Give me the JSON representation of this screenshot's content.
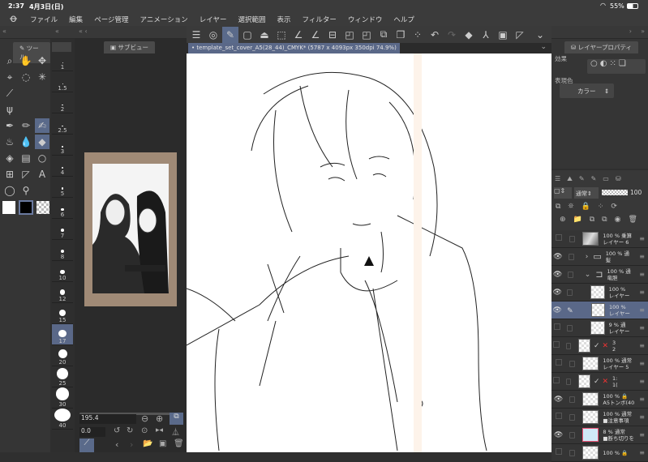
{
  "status": {
    "time": "2:37",
    "date": "4月3日(日)",
    "battery": "55%"
  },
  "menu": [
    "ファイル",
    "編集",
    "ページ管理",
    "アニメーション",
    "レイヤー",
    "選択範囲",
    "表示",
    "フィルター",
    "ウィンドウ",
    "ヘルプ"
  ],
  "panels": {
    "tool_tab": "ツール",
    "subview_tab": "サブビュー",
    "layer_property_tab": "レイヤープロパティ"
  },
  "document_tab": "template_set_cover_A5(28_44)_CMYK* (5787 x 4093px 350dpi 74.9%)",
  "brush_sizes": [
    "1",
    "1.5",
    "2",
    "2.5",
    "3",
    "4",
    "5",
    "6",
    "7",
    "8",
    "10",
    "12",
    "15",
    "17",
    "20",
    "25",
    "30",
    "40"
  ],
  "selected_brush_size": "17",
  "subview": {
    "zoom": "195.4",
    "rotation": "0.0"
  },
  "layer_property": {
    "effect_label": "効果",
    "expression_color_label": "表現色",
    "expression_color_value": "カラー"
  },
  "layer_toolbar": {
    "blend_mode": "通常",
    "opacity": "100"
  },
  "layers": [
    {
      "pct": "100 %",
      "mode": "乗算",
      "name": "レイヤー 6",
      "visible": false,
      "type": "image"
    },
    {
      "pct": "100 %",
      "mode": "通",
      "name": "髪",
      "visible": true,
      "type": "folder-closed"
    },
    {
      "pct": "100 %",
      "mode": "通",
      "name": "竜胆",
      "visible": true,
      "type": "folder-open"
    },
    {
      "pct": "100 %",
      "mode": "",
      "name": "レイヤー",
      "visible": true,
      "type": "raster"
    },
    {
      "pct": "100 %",
      "mode": "",
      "name": "レイヤー",
      "visible": true,
      "type": "raster",
      "selected": true
    },
    {
      "pct": "9 %",
      "mode": "通",
      "name": "レイヤー",
      "visible": false,
      "type": "raster"
    },
    {
      "pct": "3",
      "mode": "",
      "name": "2",
      "visible": false,
      "type": "frame"
    },
    {
      "pct": "100 %",
      "mode": "通常",
      "name": "レイヤー 5",
      "visible": false,
      "type": "raster"
    },
    {
      "pct": "1:",
      "mode": "",
      "name": "1(",
      "visible": false,
      "type": "frame"
    },
    {
      "pct": "100 %",
      "mode": "",
      "name": "A5トンボ(40",
      "visible": true,
      "type": "locked"
    },
    {
      "pct": "100 %",
      "mode": "通常",
      "name": "■注意事項",
      "visible": false,
      "type": "raster"
    },
    {
      "pct": "8 %",
      "mode": "通常",
      "name": "■断ち切りを",
      "visible": true,
      "type": "guide"
    },
    {
      "pct": "100 %",
      "mode": "",
      "name": "",
      "visible": false,
      "type": "locked"
    }
  ],
  "colors": {
    "accent": "#5a6a8a",
    "panel": "#353535",
    "canvas": "#ffffff"
  }
}
